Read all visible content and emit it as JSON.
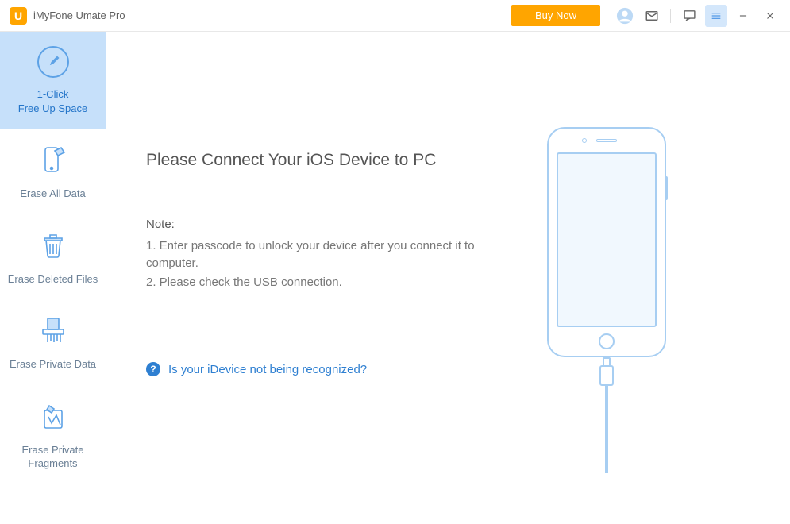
{
  "titlebar": {
    "app_name": "iMyFone Umate Pro",
    "buy_now": "Buy Now"
  },
  "sidebar": {
    "items": [
      {
        "label": "1-Click\nFree Up Space",
        "icon": "brush-icon"
      },
      {
        "label": "Erase All Data",
        "icon": "phone-erase-icon"
      },
      {
        "label": "Erase Deleted Files",
        "icon": "trash-icon"
      },
      {
        "label": "Erase Private Data",
        "icon": "shred-icon"
      },
      {
        "label": "Erase Private Fragments",
        "icon": "fragments-icon"
      }
    ]
  },
  "main": {
    "heading": "Please Connect Your iOS Device to PC",
    "note_label": "Note:",
    "note_1": "1. Enter passcode to unlock your device after you connect it to computer.",
    "note_2": "2. Please check the USB connection.",
    "help_text": "Is your iDevice not being recognized?"
  }
}
